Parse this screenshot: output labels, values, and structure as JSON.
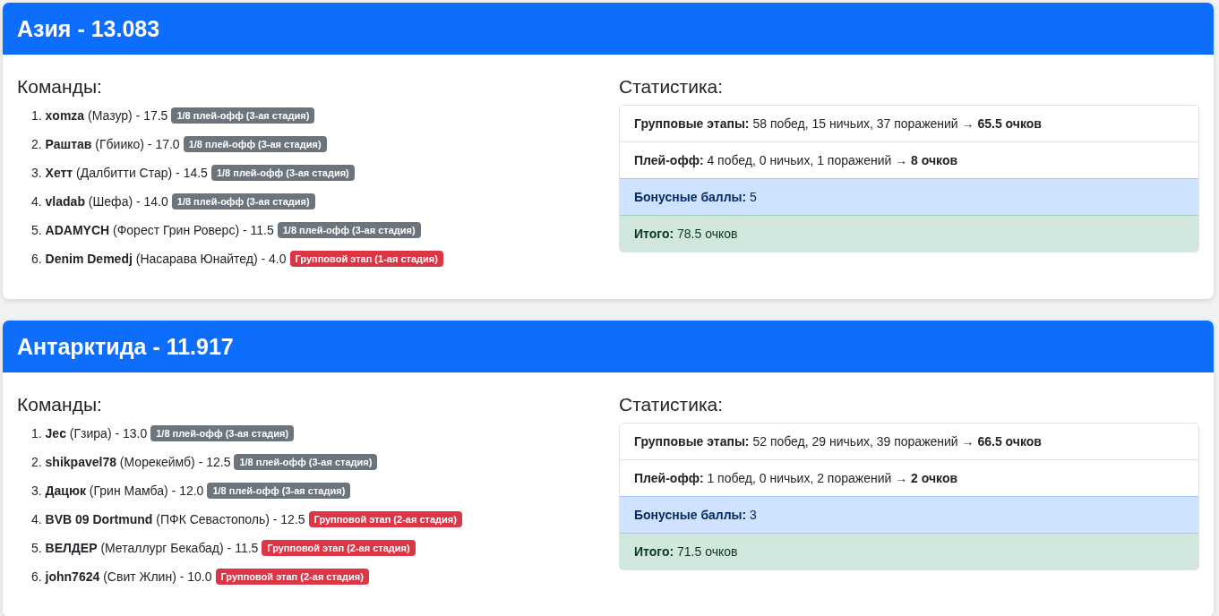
{
  "regions": [
    {
      "title": "Азия - 13.083",
      "teams_heading": "Команды:",
      "teams": [
        {
          "text": "1. **xomza** (Мазур) - 17.5",
          "stage": {
            "label": "1/8 плей-офф (3-ая стадия)",
            "kind": "playoff"
          }
        },
        {
          "text": "2. **Раштав** (Гбиико) - 17.0",
          "stage": {
            "label": "1/8 плей-офф (3-ая стадия)",
            "kind": "playoff"
          }
        },
        {
          "text": "3. **Хетт** (Далбитти Стар) - 14.5",
          "stage": {
            "label": "1/8 плей-офф (3-ая стадия)",
            "kind": "playoff"
          }
        },
        {
          "text": "4. **vladab** (Шефа) - 14.0",
          "stage": {
            "label": "1/8 плей-офф (3-ая стадия)",
            "kind": "playoff"
          }
        },
        {
          "text": "5. **ADAMYCH** (Форест Грин Роверс) - 11.5",
          "stage": {
            "label": "1/8 плей-офф (3-ая стадия)",
            "kind": "playoff"
          }
        },
        {
          "text": "6. **Denim Demedj** (Насарава Юнайтед) - 4.0",
          "stage": {
            "label": "Групповой этап (1-ая стадия)",
            "kind": "group"
          }
        }
      ],
      "stats_heading": "Статистика:",
      "stats": [
        {
          "text": "**Групповые этапы:** 58 побед, 15 ничьих, 37 поражений → **65.5 очков**",
          "kind": "plain"
        },
        {
          "text": "**Плей-офф:** 4 побед, 0 ничьих, 1 поражений → **8 очков**",
          "kind": "plain"
        },
        {
          "text": "**Бонусные баллы:** 5",
          "kind": "bonus"
        },
        {
          "text": "**Итого:** 78.5 очков",
          "kind": "total"
        }
      ]
    },
    {
      "title": "Антарктида - 11.917",
      "teams_heading": "Команды:",
      "teams": [
        {
          "text": "1. **Jec** (Гзира) - 13.0",
          "stage": {
            "label": "1/8 плей-офф (3-ая стадия)",
            "kind": "playoff"
          }
        },
        {
          "text": "2. **shikpavel78** (Морекеймб) - 12.5",
          "stage": {
            "label": "1/8 плей-офф (3-ая стадия)",
            "kind": "playoff"
          }
        },
        {
          "text": "3. **Дацюк** (Грин Мамба) - 12.0",
          "stage": {
            "label": "1/8 плей-офф (3-ая стадия)",
            "kind": "playoff"
          }
        },
        {
          "text": "4. **BVB 09 Dortmund** (ПФК Севастополь) - 12.5",
          "stage": {
            "label": "Групповой этап (2-ая стадия)",
            "kind": "group"
          }
        },
        {
          "text": "5. **ВЕЛДЕР** (Металлург Бекабад) - 11.5",
          "stage": {
            "label": "Групповой этап (2-ая стадия)",
            "kind": "group"
          }
        },
        {
          "text": "6. **john7624** (Свит Жлин) - 10.0",
          "stage": {
            "label": "Групповой этап (2-ая стадия)",
            "kind": "group"
          }
        }
      ],
      "stats_heading": "Статистика:",
      "stats": [
        {
          "text": "**Групповые этапы:** 52 побед, 29 ничьих, 39 поражений → **66.5 очков**",
          "kind": "plain"
        },
        {
          "text": "**Плей-офф:** 1 побед, 0 ничьих, 2 поражений → **2 очков**",
          "kind": "plain"
        },
        {
          "text": "**Бонусные баллы:** 3",
          "kind": "bonus"
        },
        {
          "text": "**Итого:** 71.5 очков",
          "kind": "total"
        }
      ]
    }
  ]
}
